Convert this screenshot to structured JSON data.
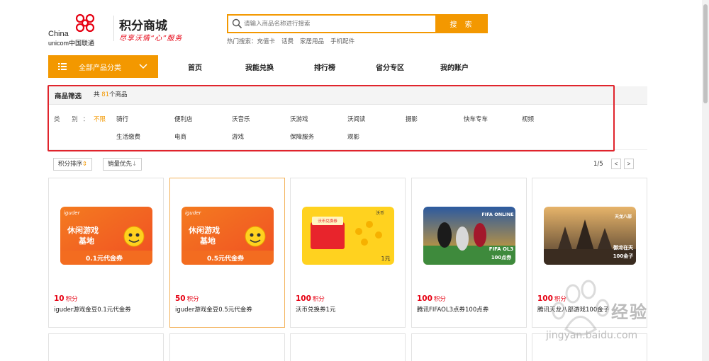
{
  "header": {
    "logo_text_line1": "China",
    "logo_text_line2": "unicom中国联通",
    "mall_title": "积分商城",
    "slogan": "尽享沃情“心”服务"
  },
  "search": {
    "placeholder": "请输入商品名称进行搜索",
    "button_label": "搜 索",
    "hot_label": "热门搜索：",
    "hot_keywords": [
      "充值卡",
      "话费",
      "家居用品",
      "手机配件"
    ]
  },
  "nav": {
    "category_label": "全部产品分类",
    "links": [
      "首页",
      "我能兑换",
      "排行榜",
      "省分专区",
      "我的账户"
    ]
  },
  "filter": {
    "title": "商品筛选",
    "count_prefix": "共 ",
    "count": "81",
    "count_suffix": "个商品",
    "category_label": "类 别：",
    "options_row1": [
      "不限",
      "骑行",
      "便利店",
      "沃音乐",
      "沃游戏",
      "沃阅读",
      "摄影",
      "快车专车",
      "视频"
    ],
    "options_row2": [
      "生活缴费",
      "电商",
      "游戏",
      "保障服务",
      "观影"
    ],
    "active_option": "不限"
  },
  "sort": {
    "points_sort": "积分排序",
    "sales_first": "销量优先",
    "page_indicator": "1/5",
    "prev": "<",
    "next": ">"
  },
  "products": [
    {
      "price": "10",
      "unit": "积分",
      "name": "iguder游戏金豆0.1元代金券",
      "img_text1": "休闲游戏",
      "img_text2": "基地",
      "img_text3": "0.1元代金券",
      "brand": "iguder"
    },
    {
      "price": "50",
      "unit": "积分",
      "name": "iguder游戏金豆0.5元代金券",
      "img_text1": "休闲游戏",
      "img_text2": "基地",
      "img_text3": "0.5元代金券",
      "brand": "iguder"
    },
    {
      "price": "100",
      "unit": "积分",
      "name": "沃币兑换券1元",
      "img_text1": "沃币兑换券",
      "img_text3": "1元",
      "brand": "沃币"
    },
    {
      "price": "100",
      "unit": "积分",
      "name": "腾讯FIFAOL3点券100点券",
      "img_text1": "FIFA OL3",
      "img_text3": "100点券",
      "brand": "FIFA ONLINE"
    },
    {
      "price": "100",
      "unit": "积分",
      "name": "腾讯天龙八部游戏100金子",
      "img_text1": "御龙在天",
      "img_text3": "100金子",
      "brand": "天龙八部"
    }
  ],
  "watermark": {
    "text": "经验",
    "url": "jingyan.baidu.com"
  },
  "colors": {
    "accent": "#f39800",
    "price": "#e60012",
    "highlight_border": "#e0242c"
  }
}
